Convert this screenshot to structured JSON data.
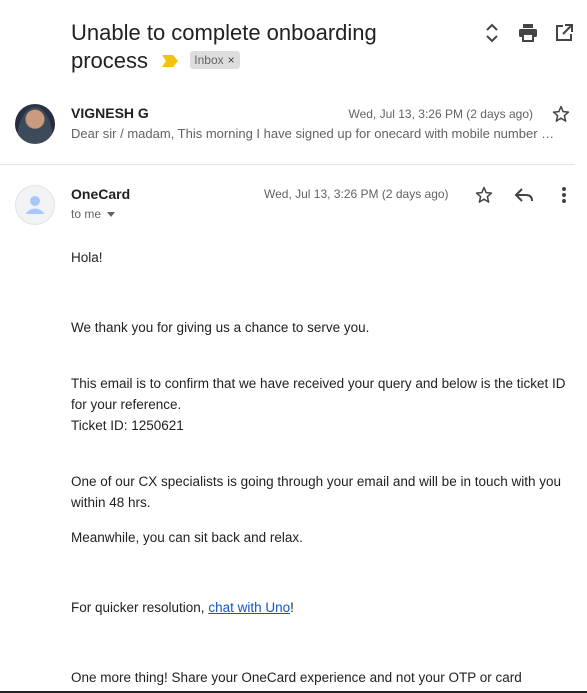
{
  "subject": {
    "title": "Unable to complete onboarding process",
    "label": "Inbox",
    "label_remove": "×"
  },
  "top_actions": [
    "expand-collapse-icon",
    "print-icon",
    "open-in-new-window-icon"
  ],
  "thread": [
    {
      "sender": "VIGNESH G",
      "date": "Wed, Jul 13, 3:26 PM (2 days ago)",
      "snippet": "Dear sir / madam, This morning I have signed up for onecard with mobile number …"
    }
  ],
  "message": {
    "sender": "OneCard",
    "recipient": "to me",
    "date": "Wed, Jul 13, 3:26 PM (2 days ago)",
    "greeting": "Hola!",
    "p1": "We thank you for giving us a chance to serve you.",
    "p2": "This email is to confirm that we have received your query and below is the ticket ID for your reference.",
    "ticket": "Ticket ID: 1250621",
    "p3": "One of our CX specialists is going through your email and will be in touch with you within 48 hrs.",
    "p4": "Meanwhile, you can sit back and relax.",
    "p5_prefix": "For quicker resolution, ",
    "p5_link": "chat with Uno",
    "p5_suffix": "!",
    "p6": "One more thing! Share your OneCard experience and not your OTP or card"
  },
  "colors": {
    "link": "#1155cc",
    "important_marker": "#f4c20d",
    "chip_bg": "#dddddd"
  }
}
